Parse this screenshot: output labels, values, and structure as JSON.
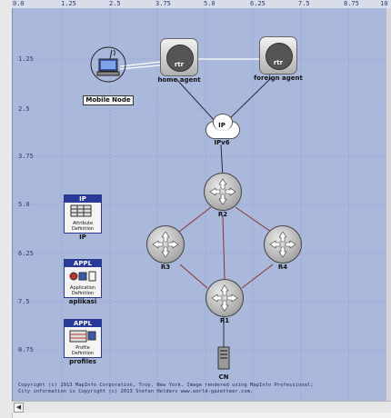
{
  "ruler": {
    "x_ticks": [
      "0.0",
      "1.25",
      "2.5",
      "3.75",
      "5.0",
      "6.25",
      "7.5",
      "8.75",
      "10"
    ],
    "y_ticks": [
      "1.25",
      "2.5",
      "3.75",
      "5.0",
      "6.25",
      "7.5",
      "8.75"
    ]
  },
  "nodes": {
    "mobile_node": "Mobile Node",
    "home_agent": "home agent",
    "foreign_agent": "foreign agent",
    "ipv6": "IPv6",
    "ip_cloud_tag": "IP",
    "r1": "R1",
    "r2": "R2",
    "r3": "R3",
    "r4": "R4",
    "cn": "CN",
    "rtr_tag": "rtr"
  },
  "palette": {
    "ip": {
      "tag": "IP",
      "sub": "Attribute Definition",
      "label": "IP"
    },
    "appl": {
      "tag": "APPL",
      "sub": "Application Definition",
      "label": "aplikasi"
    },
    "profiles": {
      "tag": "APPL",
      "sub": "Profile Definition",
      "label": "profiles"
    }
  },
  "footer": {
    "copyright_line1": "Copyright (c) 2013 MapInfo Corporation, Troy, New York. Image rendered using MapInfo Professional;",
    "copyright_line2": "City information is Copyright (c) 2013 Stefan Helders www.world-gazetteer.com."
  },
  "colors": {
    "background": "#aab8dc",
    "link_router": "#8b3030",
    "link_dark": "#2a2a3a",
    "link_wireless": "#ffffff"
  }
}
